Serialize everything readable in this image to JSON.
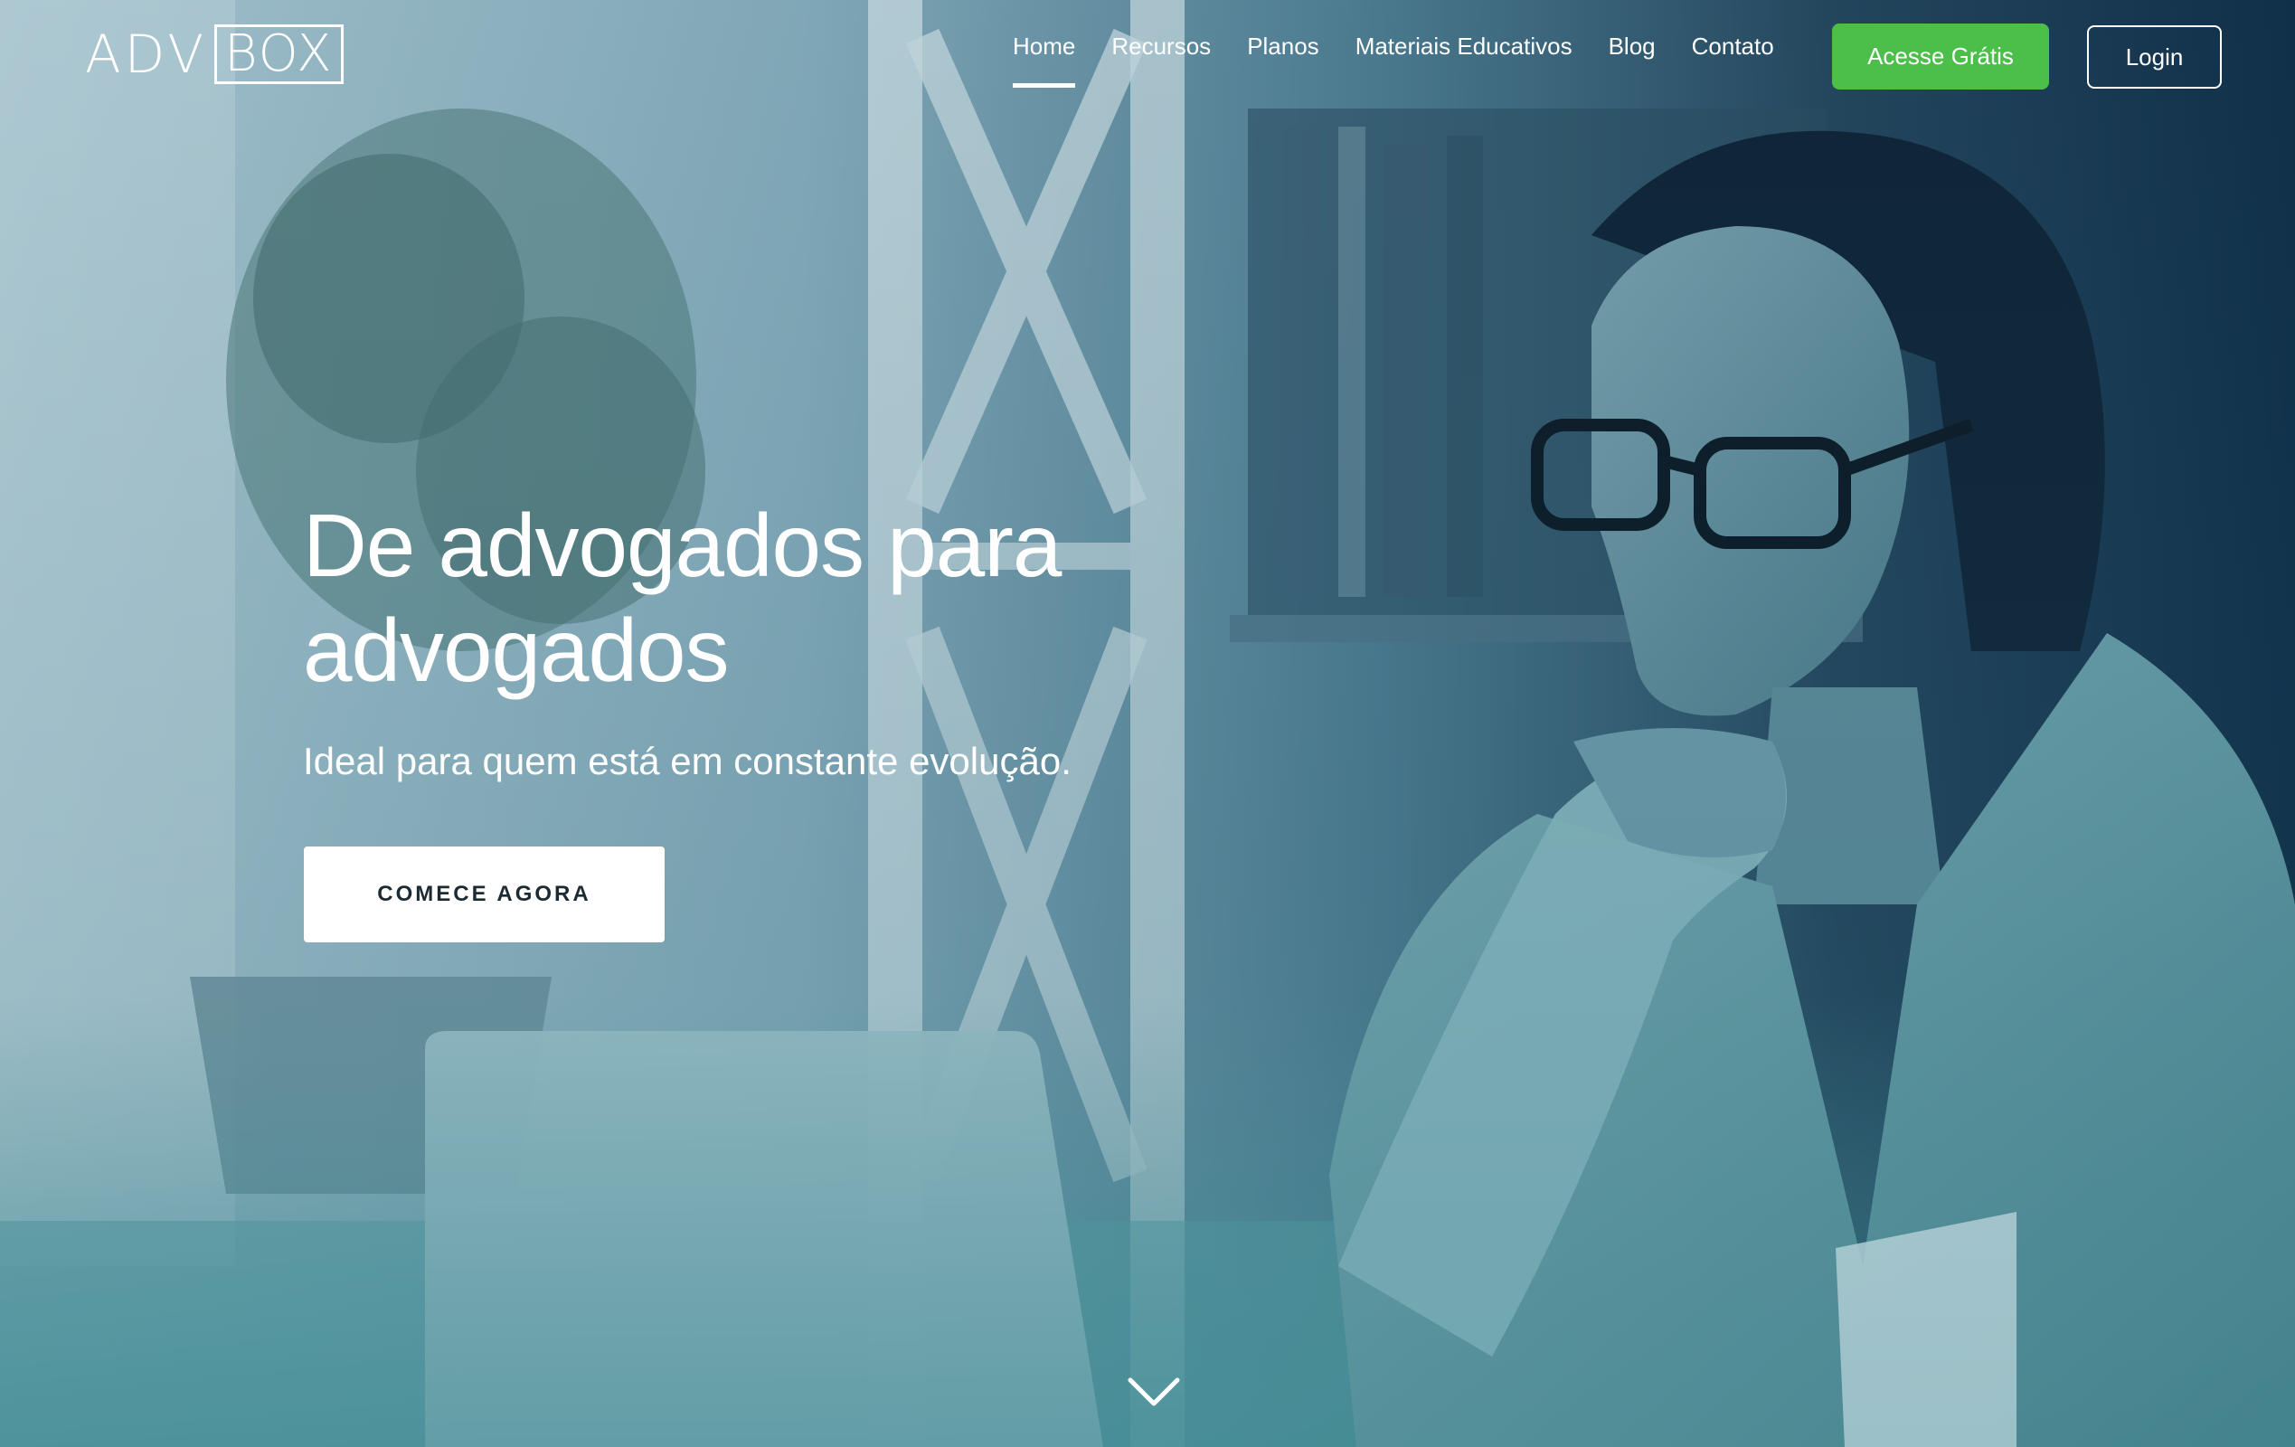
{
  "brand": {
    "logo_text_adv": "ADV",
    "logo_text_box": "BOX"
  },
  "nav": {
    "items": [
      {
        "label": "Home",
        "active": true
      },
      {
        "label": "Recursos",
        "active": false
      },
      {
        "label": "Planos",
        "active": false
      },
      {
        "label": "Materiais Educativos",
        "active": false
      },
      {
        "label": "Blog",
        "active": false
      },
      {
        "label": "Contato",
        "active": false
      }
    ],
    "cta_label": "Acesse Grátis",
    "login_label": "Login"
  },
  "hero": {
    "title": "De advogados para advogados",
    "subtitle": "Ideal para quem está em constante evolução.",
    "cta_label": "COMECE AGORA"
  },
  "icons": {
    "scroll_down": "chevron-down-icon"
  },
  "colors": {
    "accent_green": "#4cbf4b",
    "text_white": "#ffffff"
  }
}
